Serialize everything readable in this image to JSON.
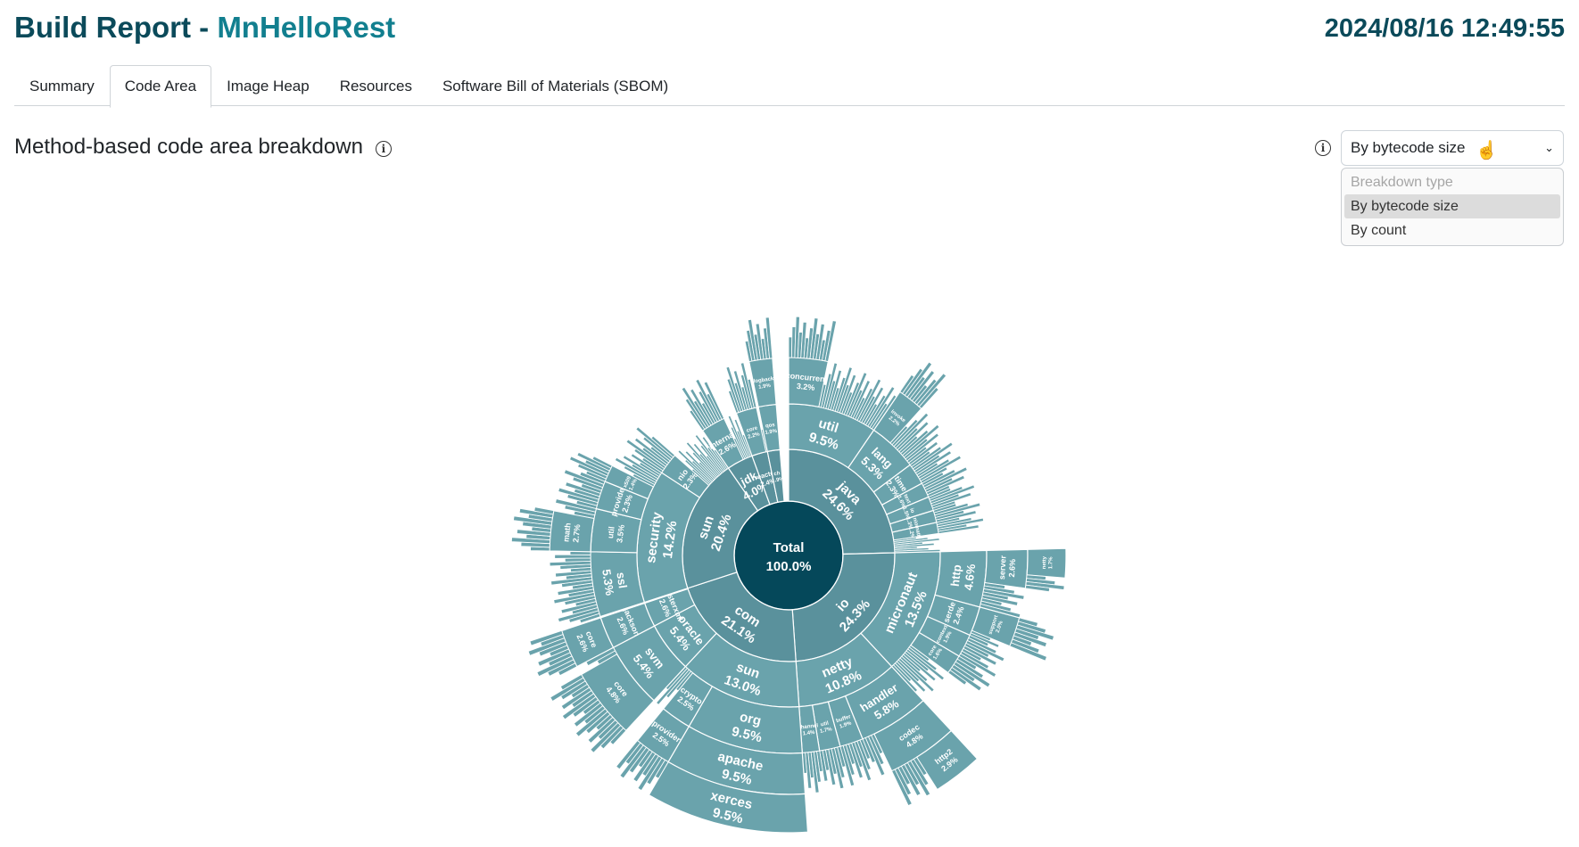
{
  "header": {
    "title_prefix": "Build Report - ",
    "app_name": "MnHelloRest",
    "datetime": "2024/08/16 12:49:55"
  },
  "tabs": [
    {
      "label": "Summary",
      "active": false
    },
    {
      "label": "Code Area",
      "active": true
    },
    {
      "label": "Image Heap",
      "active": false
    },
    {
      "label": "Resources",
      "active": false
    },
    {
      "label": "Software Bill of Materials (SBOM)",
      "active": false
    }
  ],
  "section": {
    "title": "Method-based code area breakdown",
    "info_icon": "info-icon"
  },
  "breakdown_select": {
    "value": "By bytecode size",
    "options": [
      {
        "label": "Breakdown type",
        "disabled": true
      },
      {
        "label": "By bytecode size",
        "selected": true
      },
      {
        "label": "By count"
      }
    ]
  },
  "colors": {
    "center": "#05485a",
    "ring1": "#5a919c",
    "outer": "#6aa3ac",
    "title": "#0b4a5a",
    "accent": "#127f8f"
  },
  "chart_data": {
    "type": "sunburst",
    "root": {
      "name": "Total",
      "value": 100.0,
      "children": [
        {
          "name": "java",
          "value": 24.6,
          "children": [
            {
              "name": "util",
              "value": 9.5,
              "children": [
                {
                  "name": "concurrent",
                  "value": 3.2
                }
              ]
            },
            {
              "name": "lang",
              "value": 5.3,
              "children": [
                {
                  "name": "invoke",
                  "value": 2.2
                }
              ]
            },
            {
              "name": "time",
              "value": 2.3
            },
            {
              "name": "text",
              "value": 1.6
            },
            {
              "name": "io",
              "value": 1.5
            },
            {
              "name": "nio",
              "value": 1.3
            },
            {
              "name": "math",
              "value": 1.2
            }
          ]
        },
        {
          "name": "io",
          "value": 24.3,
          "children": [
            {
              "name": "micronaut",
              "value": 13.5,
              "children": [
                {
                  "name": "http",
                  "value": 4.6,
                  "children": [
                    {
                      "name": "server",
                      "value": 2.6,
                      "children": [
                        {
                          "name": "netty",
                          "value": 1.7
                        }
                      ]
                    }
                  ]
                },
                {
                  "name": "serde",
                  "value": 2.4,
                  "children": [
                    {
                      "name": "support",
                      "value": 2.0
                    }
                  ]
                },
                {
                  "name": "context",
                  "value": 1.9
                },
                {
                  "name": "core",
                  "value": 1.6
                }
              ]
            },
            {
              "name": "netty",
              "value": 10.8,
              "children": [
                {
                  "name": "handler",
                  "value": 5.8,
                  "children": [
                    {
                      "name": "codec",
                      "value": 4.8,
                      "children": [
                        {
                          "name": "http2",
                          "value": 2.9
                        }
                      ]
                    }
                  ]
                },
                {
                  "name": "buffer",
                  "value": 1.9
                },
                {
                  "name": "util",
                  "value": 1.7
                },
                {
                  "name": "channel",
                  "value": 1.4
                }
              ]
            }
          ]
        },
        {
          "name": "com",
          "value": 21.1,
          "children": [
            {
              "name": "sun",
              "value": 13.0,
              "children": [
                {
                  "name": "org",
                  "value": 9.5,
                  "children": [
                    {
                      "name": "apache",
                      "value": 9.5,
                      "children": [
                        {
                          "name": "xerces",
                          "value": 9.5
                        }
                      ]
                    }
                  ]
                },
                {
                  "name": "crypto",
                  "value": 2.5,
                  "children": [
                    {
                      "name": "provider",
                      "value": 2.5
                    }
                  ]
                }
              ]
            },
            {
              "name": "oracle",
              "value": 5.4,
              "children": [
                {
                  "name": "svm",
                  "value": 5.4,
                  "children": [
                    {
                      "name": "core",
                      "value": 4.8
                    }
                  ]
                }
              ]
            },
            {
              "name": "fasterxml",
              "value": 2.6,
              "children": [
                {
                  "name": "jackson",
                  "value": 2.6,
                  "children": [
                    {
                      "name": "core",
                      "value": 2.6
                    }
                  ]
                }
              ]
            }
          ]
        },
        {
          "name": "sun",
          "value": 20.4,
          "children": [
            {
              "name": "security",
              "value": 14.2,
              "children": [
                {
                  "name": "ssl",
                  "value": 5.3
                },
                {
                  "name": "util",
                  "value": 3.5,
                  "children": [
                    {
                      "name": "math",
                      "value": 2.7
                    }
                  ]
                },
                {
                  "name": "provider",
                  "value": 2.3
                },
                {
                  "name": "x509",
                  "value": 1.4
                }
              ]
            },
            {
              "name": "nio",
              "value": 2.3
            }
          ]
        },
        {
          "name": "jdk",
          "value": 4.0,
          "children": [
            {
              "name": "internal",
              "value": 2.6
            }
          ]
        },
        {
          "name": "reactor",
          "value": 2.4,
          "children": [
            {
              "name": "core",
              "value": 2.2
            }
          ]
        },
        {
          "name": "ch",
          "value": 1.9,
          "children": [
            {
              "name": "qos",
              "value": 1.9,
              "children": [
                {
                  "name": "logback",
                  "value": 1.9
                }
              ]
            }
          ]
        }
      ]
    }
  }
}
